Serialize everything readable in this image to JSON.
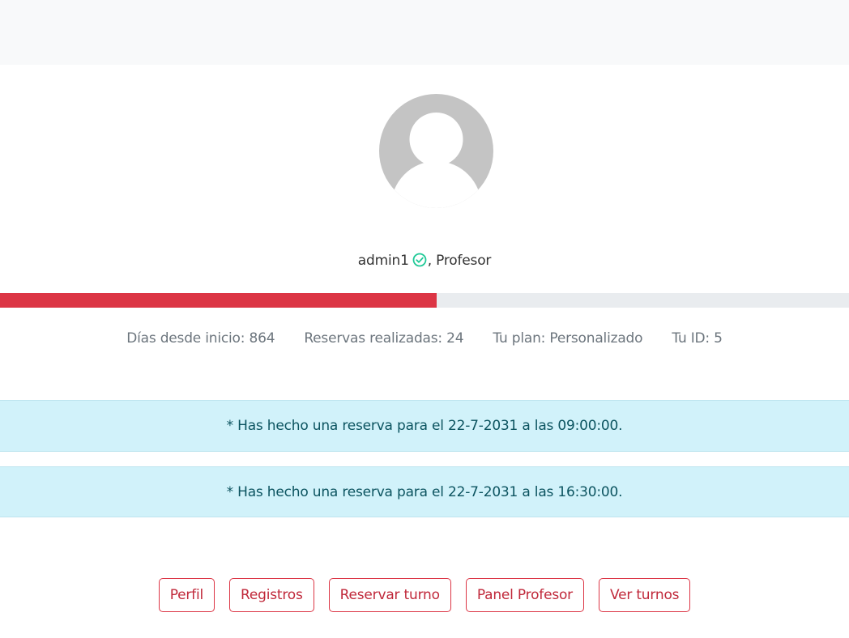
{
  "user": {
    "username": "admin1",
    "separator": ",",
    "role": "Profesor",
    "verified_icon": "check-circle-icon",
    "avatar_icon": "default-user-avatar-icon"
  },
  "progress": {
    "fraction": 0.514,
    "color": "#dc3545",
    "track_color": "#e9ecef"
  },
  "stats": [
    {
      "text": "Días desde inicio: 864"
    },
    {
      "text": "Reservas realizadas: 24"
    },
    {
      "text": "Tu plan: Personalizado"
    },
    {
      "text": "Tu ID: 5"
    }
  ],
  "alerts": [
    {
      "text": "* Has hecho una reserva para el 22-7-2031 a las 09:00:00."
    },
    {
      "text": "* Has hecho una reserva para el 22-7-2031 a las 16:30:00."
    }
  ],
  "nav": [
    {
      "label": "Perfil"
    },
    {
      "label": "Registros"
    },
    {
      "label": "Reservar turno"
    },
    {
      "label": "Panel Profesor"
    },
    {
      "label": "Ver turnos"
    }
  ],
  "colors": {
    "accent": "#dc3545",
    "verified": "#20c997",
    "alert_bg": "#d1f2fa",
    "alert_text": "#0c5460"
  }
}
